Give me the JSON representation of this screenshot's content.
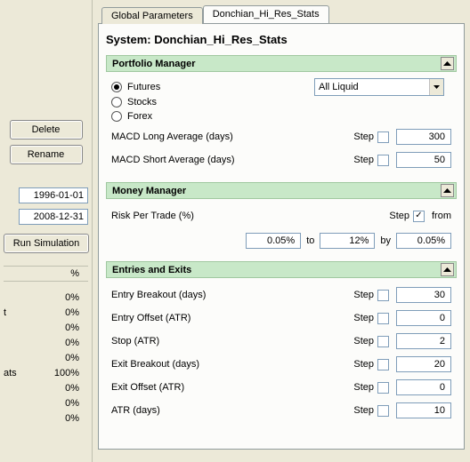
{
  "left": {
    "delete": "Delete",
    "rename": "Rename",
    "date1": "1996-01-01",
    "date2": "2008-12-31",
    "run": "Run Simulation",
    "pct_col": "%",
    "rows": [
      {
        "label": "",
        "val": "0%"
      },
      {
        "label": "t",
        "val": "0%"
      },
      {
        "label": "",
        "val": "0%"
      },
      {
        "label": "",
        "val": "0%"
      },
      {
        "label": "",
        "val": "0%"
      },
      {
        "label": "ats",
        "val": "100%"
      },
      {
        "label": "",
        "val": "0%"
      },
      {
        "label": "",
        "val": "0%"
      },
      {
        "label": "",
        "val": "0%"
      }
    ]
  },
  "tabs": {
    "global": "Global Parameters",
    "donchian": "Donchian_Hi_Res_Stats"
  },
  "system_title": "System: Donchian_Hi_Res_Stats",
  "step_label": "Step",
  "sections": {
    "portfolio": {
      "title": "Portfolio Manager",
      "radios": {
        "futures": "Futures",
        "stocks": "Stocks",
        "forex": "Forex"
      },
      "dropdown": "All Liquid",
      "macd_long": {
        "label": "MACD Long Average (days)",
        "val": "300"
      },
      "macd_short": {
        "label": "MACD Short Average (days)",
        "val": "50"
      }
    },
    "money": {
      "title": "Money Manager",
      "risk_label": "Risk Per Trade (%)",
      "from_label": "from",
      "to_label": "to",
      "by_label": "by",
      "from_val": "0.05%",
      "to_val": "12%",
      "by_val": "0.05%"
    },
    "entries": {
      "title": "Entries and Exits",
      "rows": [
        {
          "label": "Entry Breakout (days)",
          "val": "30"
        },
        {
          "label": "Entry Offset (ATR)",
          "val": "0"
        },
        {
          "label": "Stop (ATR)",
          "val": "2"
        },
        {
          "label": "Exit Breakout (days)",
          "val": "20"
        },
        {
          "label": "Exit Offset (ATR)",
          "val": "0"
        },
        {
          "label": "ATR (days)",
          "val": "10"
        }
      ]
    }
  }
}
